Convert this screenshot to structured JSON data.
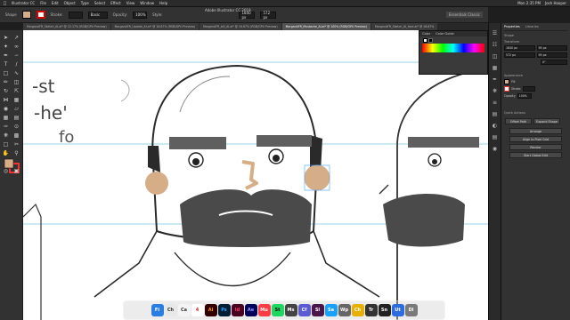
{
  "menubar": {
    "apple": "",
    "items": [
      "Illustrator CC",
      "File",
      "Edit",
      "Object",
      "Type",
      "Select",
      "Effect",
      "View",
      "Window",
      "Help"
    ],
    "right_time": "Mon 2:35 PM",
    "right_user": "Josh Hooper"
  },
  "app_title": "Adobe Illustrator CC 2019",
  "controlbar": {
    "left_label": "Shape",
    "stroke_label": "Stroke:",
    "opacity_label": "Opacity:",
    "opacity_value": "100%",
    "basic_label": "Basic",
    "style_label": "Style:",
    "w_value": "1840 px",
    "h_value": "572 px",
    "workspace": "Essentials Classic"
  },
  "tabs": [
    "MorganAFR_Sketch_AI.ai* @ 12.17% (RGB/GPU Preview)",
    "MorganAFR_Update_AI.ai* @ 16.67% (RGB/GPU Preview)",
    "MorganAFR_bill_AI.ai* @ 16.67% (RGB/GPU Preview)",
    "MorganAFR_Mustache_AI.ai* @ 100% (RGB/GPU Preview)",
    "MorganAFR_Sketch_AI_face.ai* @ 16.67%"
  ],
  "active_tab": 3,
  "color_panel": {
    "tab1": "Color",
    "tab2": "Color Guide"
  },
  "props": {
    "tab1": "Properties",
    "tab2": "Libraries",
    "sec_shape": "Shape",
    "sec_transform": "Transform",
    "x": "1840 px",
    "y": "572 px",
    "w": "95 px",
    "h": "95 px",
    "angle": "0°",
    "sec_appearance": "Appearance",
    "fill": "Fill",
    "stroke": "Stroke",
    "opacity": "Opacity",
    "opacity_val": "100%",
    "sec_quick": "Quick Actions",
    "btn1": "Offset Path",
    "btn2": "Expand Shape",
    "btn3": "Arrange",
    "btn4": "Align to Pixel Grid",
    "btn5": "Recolor",
    "btn6": "Start Global Edit"
  },
  "sketch_notes": [
    "-st",
    "-he'",
    "fo"
  ],
  "colors": {
    "skin": "#d5ad86",
    "brow": "#5f5f5f",
    "mustache": "#4a4a4a",
    "guide": "#76c8e2"
  },
  "dock_apps": [
    "Fi",
    "Ch",
    "Ca",
    "4",
    "Ai",
    "Ps",
    "Id",
    "Ae",
    "Mu",
    "St",
    "Ms",
    "Cf",
    "Sl",
    "Sa",
    "Wp",
    "Ch",
    "Tr",
    "Sn",
    "Ut",
    "Dl"
  ]
}
